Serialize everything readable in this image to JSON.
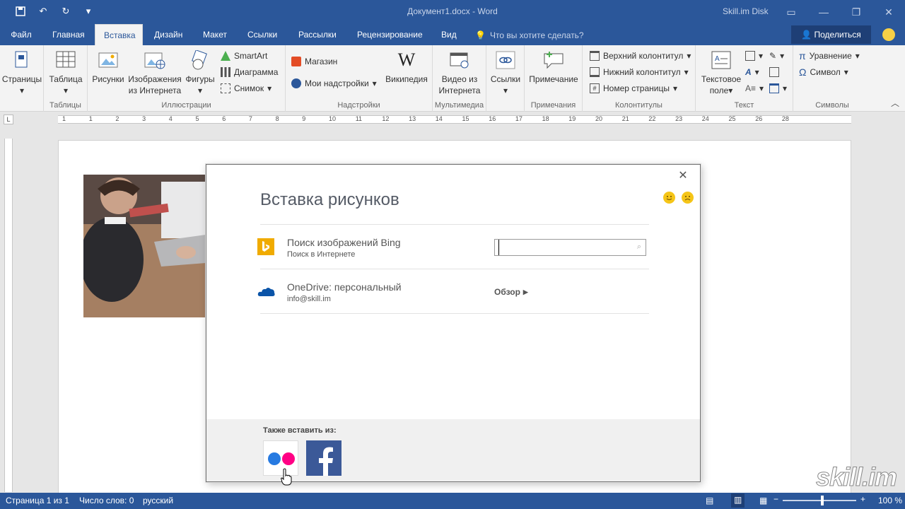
{
  "window": {
    "title": "Документ1.docx - Word",
    "disk_label": "Skill.im Disk"
  },
  "tabs": {
    "file": "Файл",
    "items": [
      "Главная",
      "Вставка",
      "Дизайн",
      "Макет",
      "Ссылки",
      "Рассылки",
      "Рецензирование",
      "Вид"
    ],
    "active": "Вставка",
    "tellme": "Что вы хотите сделать?",
    "share": "Поделиться"
  },
  "ribbon": {
    "pages": "Страницы",
    "table": "Таблица",
    "tables_group": "Таблицы",
    "pictures": "Рисунки",
    "online_pictures_1": "Изображения",
    "online_pictures_2": "из Интернета",
    "shapes": "Фигуры",
    "smartart": "SmartArt",
    "chart": "Диаграмма",
    "screenshot": "Снимок",
    "illustrations_group": "Иллюстрации",
    "store": "Магазин",
    "my_addins": "Мои надстройки",
    "wikipedia": "Википедия",
    "addins_group": "Надстройки",
    "video_1": "Видео из",
    "video_2": "Интернета",
    "media_group": "Мультимедиа",
    "links": "Ссылки",
    "comment": "Примечание",
    "comments_group": "Примечания",
    "header": "Верхний колонтитул",
    "footer": "Нижний колонтитул",
    "page_number": "Номер страницы",
    "headerfooter_group": "Колонтитулы",
    "textbox_1": "Текстовое",
    "textbox_2": "поле",
    "text_group": "Текст",
    "equation": "Уравнение",
    "symbol": "Символ",
    "symbols_group": "Символы"
  },
  "ruler": {
    "ticks": [
      "1",
      "1",
      "2",
      "3",
      "4",
      "5",
      "6",
      "7",
      "8",
      "9",
      "10",
      "11",
      "12",
      "13",
      "14",
      "15",
      "16",
      "17",
      "18",
      "19",
      "20",
      "21",
      "22",
      "23",
      "24",
      "25",
      "26",
      "28"
    ]
  },
  "dialog": {
    "title": "Вставка рисунков",
    "bing_title": "Поиск изображений Bing",
    "bing_sub": "Поиск в Интернете",
    "search_placeholder": "",
    "onedrive_title": "OneDrive: персональный",
    "onedrive_sub": "info@skill.im",
    "browse": "Обзор",
    "also_insert": "Также вставить из:"
  },
  "status": {
    "page": "Страница 1 из 1",
    "words": "Число слов: 0",
    "language": "русский",
    "zoom": "100 %",
    "zoom_level": 100
  },
  "watermark": "skill.im",
  "colors": {
    "accent": "#2b579a",
    "share_bg": "#1e3f76",
    "bing": "#f0ab00",
    "onedrive": "#0a54a8",
    "facebook": "#3b5998",
    "flickr_blue": "#0063dc",
    "flickr_pink": "#ff0084"
  }
}
